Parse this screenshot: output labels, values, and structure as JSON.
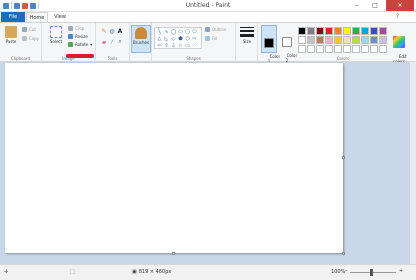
{
  "window": {
    "title": "Untitled - Paint",
    "min": "–",
    "max": "□",
    "close": "✕"
  },
  "tabs": {
    "file": "File",
    "home": "Home",
    "view": "View",
    "help": "?"
  },
  "ribbon": {
    "clipboard": {
      "paste": "Paste",
      "cut": "Cut",
      "copy": "Copy",
      "label": "Clipboard"
    },
    "image": {
      "select": "Select",
      "crop": "Crop",
      "resize": "Resize",
      "rotate": "Rotate",
      "label": "Image"
    },
    "tools": {
      "label": "Tools",
      "text_glyph": "A"
    },
    "brushes": "Brushes",
    "shapes": {
      "outline": "Outline",
      "fill": "Fill",
      "label": "Shapes"
    },
    "size": "Size",
    "color1": "Color\n1",
    "color2": "Color\n2",
    "colors_label": "Colors",
    "edit_colors": "Edit\ncolors",
    "swatches": [
      "#000000",
      "#7f7f7f",
      "#880015",
      "#ed1c24",
      "#ff7f27",
      "#fff200",
      "#22b14c",
      "#00a2e8",
      "#3f48cc",
      "#a349a4",
      "#ffffff",
      "#c3c3c3",
      "#b97a57",
      "#ffaec9",
      "#ffc90e",
      "#efe4b0",
      "#b5e61d",
      "#99d9ea",
      "#7092be",
      "#c8bfe7",
      "#ffffff",
      "#ffffff",
      "#ffffff",
      "#ffffff",
      "#ffffff",
      "#ffffff",
      "#ffffff",
      "#ffffff",
      "#ffffff",
      "#ffffff"
    ]
  },
  "status": {
    "dimensions": "819 × 460px",
    "zoom": "100%",
    "zoom_minus": "–",
    "zoom_plus": "+"
  }
}
